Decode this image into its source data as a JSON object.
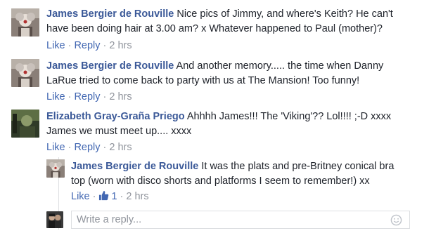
{
  "comments": [
    {
      "author": "James Bergier de Rouville",
      "text": " Nice pics of Jimmy, and where's Keith? He can't have been doing hair at 3.00 am? x Whatever happened to Paul (mother)?",
      "like": "Like",
      "reply": "Reply",
      "time": "2 hrs",
      "avatar_icon": "clown-portrait-avatar"
    },
    {
      "author": "James Bergier de Rouville",
      "text": " And another memory..... the time when Danny LaRue tried to come back to party with us at The Mansion! Too funny!",
      "like": "Like",
      "reply": "Reply",
      "time": "2 hrs",
      "avatar_icon": "clown-portrait-avatar"
    },
    {
      "author": "Elizabeth Gray-Graña Priego",
      "text": " Ahhhh James!!! The 'Viking'?? Lol!!!! ;-D xxxx James we must meet up.... xxxx",
      "like": "Like",
      "reply": "Reply",
      "time": "2 hrs",
      "avatar_icon": "green-photo-avatar"
    }
  ],
  "reply": {
    "author": "James Bergier de Rouville",
    "text": " It was the plats and pre-Britney conical bra top (worn with disco shorts and platforms I seem to remember!) xx",
    "like": "Like",
    "like_count": "1",
    "time": "2 hrs"
  },
  "composer": {
    "placeholder": "Write a reply...",
    "icon": "emoji-icon"
  },
  "separator": "·",
  "colors": {
    "author": "#3b5998",
    "link": "#4267b2",
    "meta": "#90949c"
  }
}
